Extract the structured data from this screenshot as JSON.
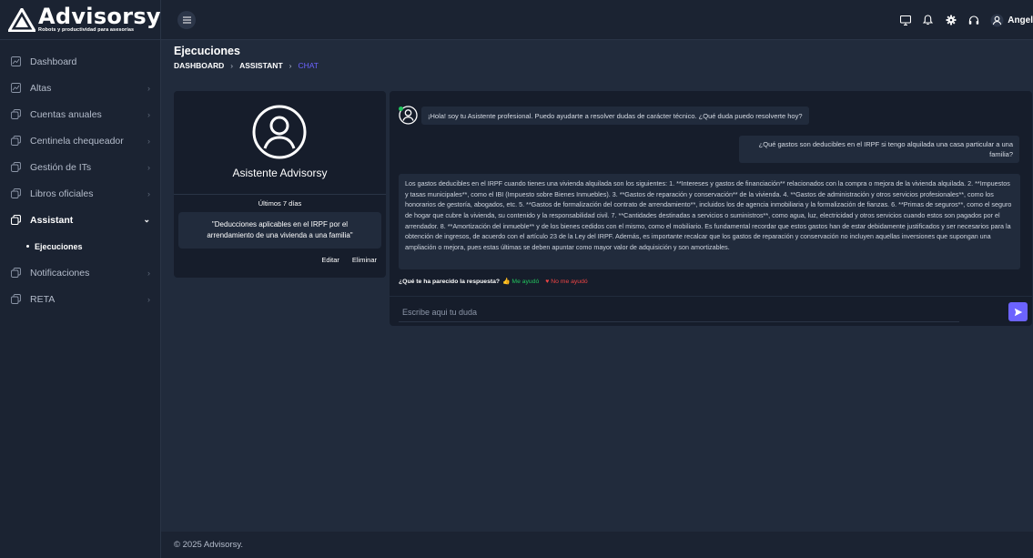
{
  "brand": {
    "name": "Advisorsy",
    "tagline": "Robots y productividad para asesorías"
  },
  "sidebar": {
    "items": [
      {
        "label": "Dashboard",
        "icon": "chart-line-icon",
        "chevron": ""
      },
      {
        "label": "Altas",
        "icon": "chart-line-icon",
        "chevron": "›"
      },
      {
        "label": "Cuentas anuales",
        "icon": "copy-icon",
        "chevron": "›"
      },
      {
        "label": "Centinela chequeador",
        "icon": "copy-icon",
        "chevron": "›"
      },
      {
        "label": "Gestión de ITs",
        "icon": "copy-icon",
        "chevron": "›"
      },
      {
        "label": "Libros oficiales",
        "icon": "copy-icon",
        "chevron": "›"
      },
      {
        "label": "Assistant",
        "icon": "copy-icon",
        "chevron": "⌄"
      },
      {
        "label": "Notificaciones",
        "icon": "copy-icon",
        "chevron": "›"
      },
      {
        "label": "RETA",
        "icon": "copy-icon",
        "chevron": "›"
      }
    ],
    "sub_item": "Ejecuciones"
  },
  "topbar": {
    "user_name": "Angel"
  },
  "page": {
    "title": "Ejecuciones",
    "breadcrumb": [
      "DASHBOARD",
      "ASSISTANT",
      "CHAT"
    ]
  },
  "assistant_card": {
    "name": "Asistente Advisorsy",
    "period": "Últimos 7 días",
    "history_item": "\"Deducciones aplicables en el IRPF por el arrendamiento de una vivienda a una familia\"",
    "edit_label": "Editar",
    "delete_label": "Eliminar"
  },
  "chat": {
    "greeting": "¡Hola! soy tu Asistente profesional. Puedo ayudarte a resolver dudas de carácter técnico. ¿Qué duda puedo resolverte hoy?",
    "user_question": "¿Qué gastos son deducibles en el IRPF si tengo alquilada una casa particular a una familia?",
    "answer": "Los gastos deducibles en el IRPF cuando tienes una vivienda alquilada son los siguientes: 1. **Intereses y gastos de financiación** relacionados con la compra o mejora de la vivienda alquilada. 2. **Impuestos y tasas municipales**, como el IBI (Impuesto sobre Bienes Inmuebles). 3. **Gastos de reparación y conservación** de la vivienda. 4. **Gastos de administración y otros servicios profesionales**, como los honorarios de gestoría, abogados, etc. 5. **Gastos de formalización del contrato de arrendamiento**, incluidos los de agencia inmobiliaria y la formalización de fianzas. 6. **Primas de seguros**, como el seguro de hogar que cubre la vivienda, su contenido y la responsabilidad civil. 7. **Cantidades destinadas a servicios o suministros**, como agua, luz, electricidad y otros servicios cuando estos son pagados por el arrendador. 8. **Amortización del inmueble** y de los bienes cedidos con el mismo, como el mobiliario. Es fundamental recordar que estos gastos han de estar debidamente justificados y ser necesarios para la obtención de ingresos, de acuerdo con el artículo 23 de la Ley del IRPF. Además, es importante recalcar que los gastos de reparación y conservación no incluyen aquellas inversiones que supongan una ampliación o mejora, pues estas últimas se deben apuntar como mayor valor de adquisición y son amortizables.",
    "feedback_question": "¿Qué te ha parecido la respuesta?",
    "feedback_yes": "Me ayudó",
    "feedback_no": "No me ayudó",
    "input_placeholder": "Escribe aqui tu duda"
  },
  "footer": {
    "text": "© 2025 Advisorsy."
  },
  "colors": {
    "accent": "#6c63ff",
    "success": "#22c55e",
    "danger": "#ef4444",
    "sidebar_bg": "#1b2332",
    "content_bg": "#212b3c",
    "card_bg": "#161d2b"
  }
}
